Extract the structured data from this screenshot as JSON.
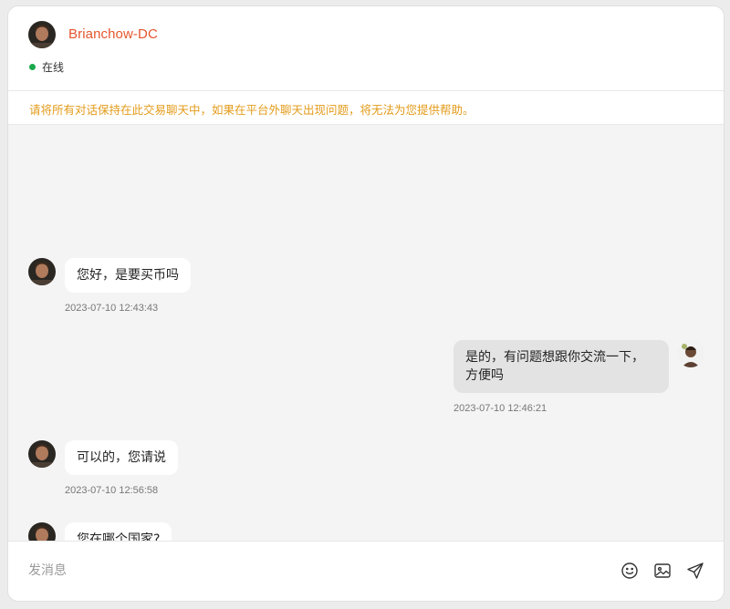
{
  "header": {
    "username": "Brianchow-DC",
    "status": "在线"
  },
  "warning": "请将所有对话保持在此交易聊天中，如果在平台外聊天出现问题，将无法为您提供帮助。",
  "messages": [
    {
      "side": "in",
      "text": "您好，是要买币吗",
      "time": "2023-07-10 12:43:43"
    },
    {
      "side": "out",
      "text_line1": "是的，有问题想跟你交流一下，",
      "text_line2": "方便吗",
      "time": "2023-07-10 12:46:21"
    },
    {
      "side": "in",
      "text": "可以的，您请说",
      "time": "2023-07-10 12:56:58"
    },
    {
      "side": "in",
      "text": "您在哪个国家?"
    }
  ],
  "composer": {
    "placeholder": "发消息",
    "icons": [
      "emoji-icon",
      "image-icon",
      "send-icon"
    ]
  },
  "colors": {
    "username": "#e4572e",
    "online": "#1aa94b",
    "warning": "#e39b1a"
  }
}
